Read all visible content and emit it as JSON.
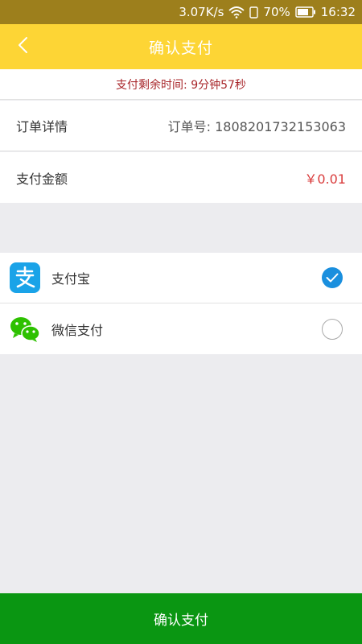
{
  "status_bar": {
    "speed": "3.07K/s",
    "battery": "70%",
    "time": "16:32"
  },
  "header": {
    "title": "确认支付"
  },
  "countdown": {
    "text": "支付剩余时间: 9分钟57秒"
  },
  "order": {
    "label": "订单详情",
    "number": "订单号: 1808201732153063"
  },
  "amount": {
    "label": "支付金额",
    "value": "￥0.01"
  },
  "payment_methods": [
    {
      "name": "支付宝",
      "icon": "alipay-icon",
      "selected": true
    },
    {
      "name": "微信支付",
      "icon": "wechat-icon",
      "selected": false
    }
  ],
  "footer": {
    "confirm_label": "确认支付"
  },
  "colors": {
    "header_bg": "#fdd535",
    "status_bg": "#9d7f1c",
    "confirm_bg": "#0a9612",
    "price": "#d93b3b",
    "countdown": "#a8262a",
    "radio_selected": "#1a8fde"
  }
}
